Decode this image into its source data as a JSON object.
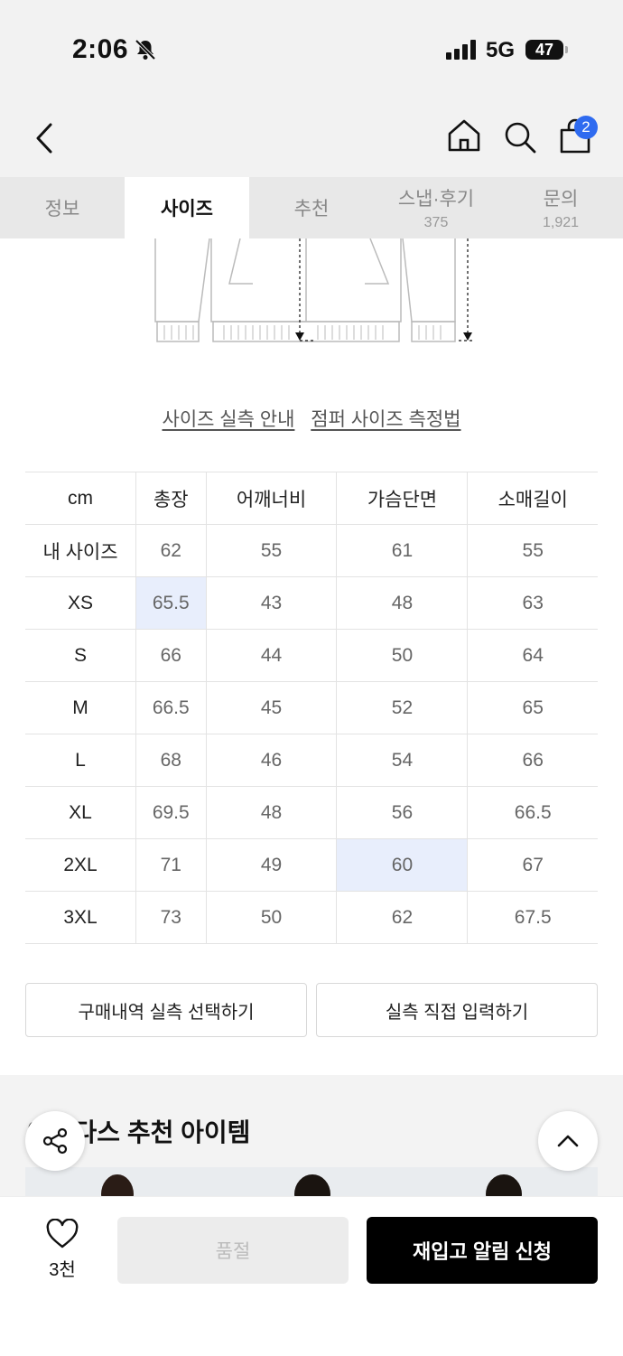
{
  "status_bar": {
    "time": "2:06",
    "network": "5G",
    "battery": "47"
  },
  "header": {
    "cart_count": "2"
  },
  "tabs": [
    {
      "label": "정보",
      "count": ""
    },
    {
      "label": "사이즈",
      "count": ""
    },
    {
      "label": "추천",
      "count": ""
    },
    {
      "label": "스냅·후기",
      "count": "375"
    },
    {
      "label": "문의",
      "count": "1,921"
    }
  ],
  "size_links": {
    "guide": "사이즈 실측 안내",
    "method": "점퍼 사이즈 측정법"
  },
  "size_table": {
    "headers": [
      "cm",
      "총장",
      "어깨너비",
      "가슴단면",
      "소매길이"
    ],
    "rows": [
      {
        "label": "내 사이즈",
        "values": [
          "62",
          "55",
          "61",
          "55"
        ]
      },
      {
        "label": "XS",
        "values": [
          "65.5",
          "43",
          "48",
          "63"
        ]
      },
      {
        "label": "S",
        "values": [
          "66",
          "44",
          "50",
          "64"
        ]
      },
      {
        "label": "M",
        "values": [
          "66.5",
          "45",
          "52",
          "65"
        ]
      },
      {
        "label": "L",
        "values": [
          "68",
          "46",
          "54",
          "66"
        ]
      },
      {
        "label": "XL",
        "values": [
          "69.5",
          "48",
          "56",
          "66.5"
        ]
      },
      {
        "label": "2XL",
        "values": [
          "71",
          "49",
          "60",
          "67"
        ]
      },
      {
        "label": "3XL",
        "values": [
          "73",
          "50",
          "62",
          "67.5"
        ]
      }
    ],
    "highlight_color": "#e8eefc"
  },
  "actions": {
    "purchase_history": "구매내역 실측 선택하기",
    "manual_input": "실측 직접 입력하기"
  },
  "recommend": {
    "title": "아디다스 추천 아이템"
  },
  "bottom_bar": {
    "likes": "3천",
    "sold_out": "품절",
    "restock": "재입고 알림 신청"
  },
  "colors": {
    "accent": "#2f6bf0",
    "primary_button": "#000000"
  }
}
